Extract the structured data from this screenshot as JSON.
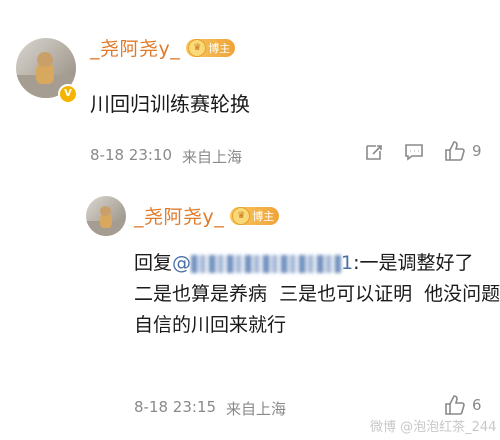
{
  "comment": {
    "username": "_尧阿尧y_",
    "badge_label": "博主",
    "text": "川回归训练赛轮换",
    "date": "8-18 23:10",
    "location": "来自上海",
    "like_count": "9",
    "avatar_icon": "dog-avatar",
    "verified_icon": "v-badge-icon"
  },
  "reply": {
    "username": "_尧阿尧y_",
    "badge_label": "博主",
    "prefix": "回复",
    "at_symbol": "@",
    "mention_suffix": "1",
    "line1_rest": ":一是调整好了",
    "line2": "二是也算是养病  三是也可以证明  他没问题",
    "line3": "自信的川回来就行",
    "date": "8-18 23:15",
    "location": "来自上海",
    "like_count": "6",
    "avatar_icon": "dog-avatar"
  },
  "watermark": {
    "text": "微博 @泡泡红茶_244"
  },
  "colors": {
    "username": "#e07a2b",
    "meta": "#8a8a8a",
    "badge": "#f0a33a"
  }
}
